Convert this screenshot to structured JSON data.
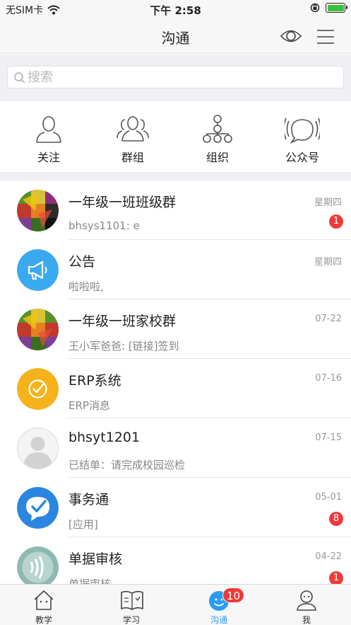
{
  "status_bar": {
    "carrier": "无SIM卡",
    "time": "下午 2:58",
    "battery_level": 1.0
  },
  "header": {
    "title": "沟通",
    "eye_icon": "eye-icon",
    "menu_icon": "menu-icon"
  },
  "search": {
    "placeholder": "搜索",
    "icon": "search-icon"
  },
  "quick_entries": [
    {
      "label": "关注",
      "icon": "person-icon"
    },
    {
      "label": "群组",
      "icon": "group-icon"
    },
    {
      "label": "组织",
      "icon": "org-chart-icon"
    },
    {
      "label": "公众号",
      "icon": "broadcast-icon"
    }
  ],
  "chats": [
    {
      "name": "一年级一班班级群",
      "preview": "bhsys1101: e",
      "time": "星期四",
      "badge": "1",
      "avatar": "mosaic-avatar"
    },
    {
      "name": "公告",
      "preview": "啦啦啦,",
      "time": "星期四",
      "badge": "",
      "avatar": "megaphone-avatar"
    },
    {
      "name": "一年级一班家校群",
      "preview": "王小军爸爸: [链接]签到",
      "time": "07-22",
      "badge": "",
      "avatar": "mosaic-avatar"
    },
    {
      "name": "ERP系统",
      "preview": "ERP消息",
      "time": "07-16",
      "badge": "",
      "avatar": "check-circle-avatar"
    },
    {
      "name": "bhsyt1201",
      "preview": "已结单：请完成校园巡检",
      "time": "07-15",
      "badge": "",
      "avatar": "default-user-avatar"
    },
    {
      "name": "事务通",
      "preview": "[应用]",
      "time": "05-01",
      "badge": "8",
      "avatar": "chat-check-avatar"
    },
    {
      "name": "单据审核",
      "preview": "单据审核",
      "time": "04-22",
      "badge": "1",
      "avatar": "signal-avatar"
    }
  ],
  "tabs": [
    {
      "label": "教学",
      "icon": "house-icon",
      "active": false
    },
    {
      "label": "学习",
      "icon": "book-icon",
      "active": false
    },
    {
      "label": "沟通",
      "icon": "chat-bubble-icon",
      "active": true,
      "badge": "10"
    },
    {
      "label": "我",
      "icon": "profile-icon",
      "active": false
    }
  ],
  "colors": {
    "accent": "#2b9cf5",
    "badge": "#f03a3a",
    "background": "#efeff4",
    "announcement": "#3aa9f0",
    "erp": "#f5b21b"
  }
}
